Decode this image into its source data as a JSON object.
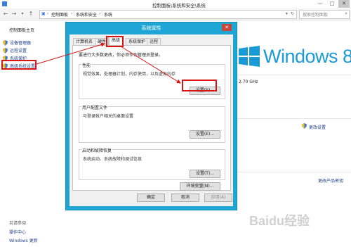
{
  "window": {
    "title": "控制面板\\系统和安全\\系统",
    "minimize": "—",
    "maximize": "□",
    "close": "✕"
  },
  "address": {
    "breadcrumb": [
      "控制面板",
      "系统和安全",
      "系统"
    ],
    "search_placeholder": "搜索控制面板"
  },
  "left_pane": {
    "home": "控制面板主页",
    "items": [
      {
        "label": "设备管理器"
      },
      {
        "label": "远程设置"
      },
      {
        "label": "系统保护"
      },
      {
        "label": "高级系统设置"
      }
    ],
    "see_also": "另请参阅",
    "footer_links": [
      "操作中心",
      "Windows 更新"
    ]
  },
  "background": {
    "windows_logo_text": "Windows 8",
    "processor_speed": "2.70 GHz",
    "change_settings": "更改设置",
    "change_product_key": "更改产品密钥"
  },
  "dialog": {
    "title": "系统属性",
    "close": "✕",
    "tabs": [
      {
        "label": "计算机名"
      },
      {
        "label": "硬件"
      },
      {
        "label": "高级"
      },
      {
        "label": "系统保护"
      },
      {
        "label": "远程"
      }
    ],
    "admin_note": "要进行大多数更改，你必须作为管理员登录。",
    "groups": [
      {
        "title": "性能",
        "desc": "视觉效果，处理器计划，内存使用，以及虚拟内存",
        "button": "设置(S)..."
      },
      {
        "title": "用户配置文件",
        "desc": "与登录帐户相关的桌面设置",
        "button": "设置(E)..."
      },
      {
        "title": "启动和故障恢复",
        "desc": "系统启动、系统故障和调试信息",
        "button": "设置(T)..."
      }
    ],
    "env_button": "环境变量(N)...",
    "ok": "确定",
    "cancel": "取消",
    "apply": "应用(A)"
  },
  "colors": {
    "accent": "#1ea7d6",
    "annotation": "#d81414",
    "link": "#1e3f8a",
    "logo": "#1a9ad6"
  },
  "watermark": "Baidu经验"
}
